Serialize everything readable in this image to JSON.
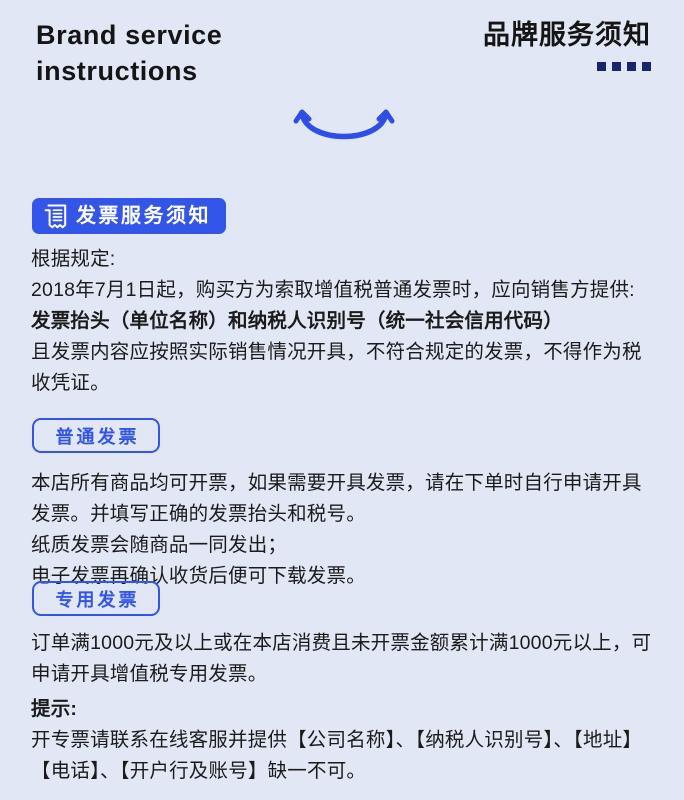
{
  "colors": {
    "background": "#e1e7f5",
    "accent_blue": "#3355e8",
    "square_navy": "#19256b",
    "text": "#1b1b1b"
  },
  "header": {
    "title_en": "Brand service instructions",
    "title_cn": "品牌服务须知",
    "squares_count": 4,
    "decoration_icon": "smile-arc-icon"
  },
  "invoice_notice": {
    "badge": {
      "icon": "invoice-document-icon",
      "label": "发票服务须知"
    },
    "lines": [
      {
        "text": "根据规定:",
        "bold": false
      },
      {
        "text": "2018年7月1日起，购买方为索取增值税普通发票时，应向销售方提供:",
        "bold": false
      },
      {
        "text": "发票抬头（单位名称）和纳税人识别号（统一社会信用代码）",
        "bold": true
      },
      {
        "text": "且发票内容应按照实际销售情况开具，不符合规定的发票，不得作为税收凭证。",
        "bold": false
      }
    ]
  },
  "ordinary_invoice": {
    "badge_label": "普通发票",
    "lines": [
      {
        "text": "本店所有商品均可开票，如果需要开具发票，请在下单时自行申请开具发票。并填写正确的发票抬头和税号。",
        "bold": false
      },
      {
        "text": "纸质发票会随商品一同发出；",
        "bold": false
      },
      {
        "text": "电子发票再确认收货后便可下载发票。",
        "bold": false
      }
    ]
  },
  "special_invoice": {
    "badge_label": "专用发票",
    "lines": [
      {
        "text": "订单满1000元及以上或在本店消费且未开票金额累计满1000元以上，可申请开具增值税专用发票。",
        "bold": false
      }
    ]
  },
  "tips": {
    "title": "提示:",
    "lines": [
      {
        "text": "开专票请联系在线客服并提供【公司名称】、【纳税人识别号】、【地址】【电话】、【开户行及账号】缺一不可。",
        "bold": false
      }
    ]
  }
}
